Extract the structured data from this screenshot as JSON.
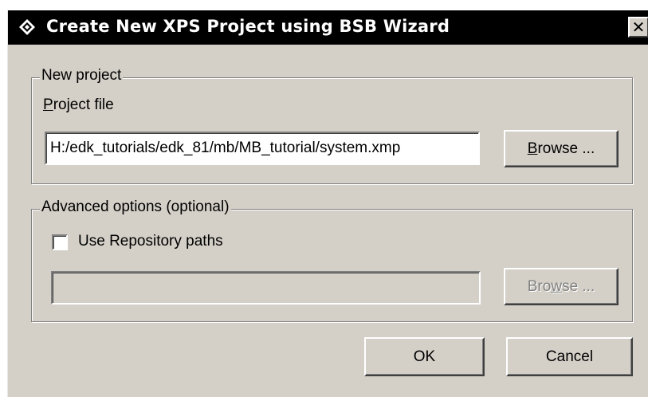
{
  "window": {
    "title": "Create New XPS Project using BSB Wizard",
    "icon": "xps-diamond-icon",
    "close_label": "✕"
  },
  "new_project": {
    "legend": "New project",
    "project_file_label_underlined": "P",
    "project_file_label_rest": "roject file",
    "project_file_value": "H:/edk_tutorials/edk_81/mb/MB_tutorial/system.xmp",
    "browse_underlined": "B",
    "browse_rest": "rowse ..."
  },
  "advanced": {
    "legend": "Advanced options (optional)",
    "use_repository_label": "Use Repository paths",
    "use_repository_checked": false,
    "repository_path_value": "",
    "browse_before": "Bro",
    "browse_underlined": "w",
    "browse_after": "se ..."
  },
  "footer": {
    "ok_label": "OK",
    "cancel_label": "Cancel"
  }
}
